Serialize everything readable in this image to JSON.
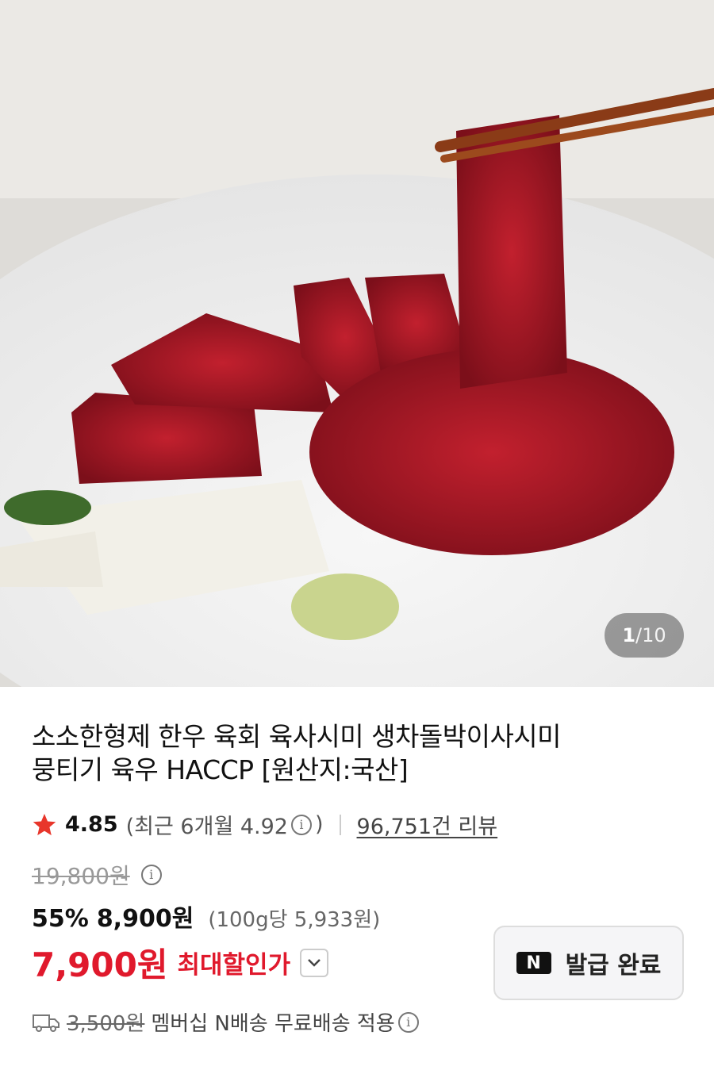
{
  "image": {
    "counter_current": "1",
    "counter_separator": "/",
    "counter_total": "10"
  },
  "product": {
    "title_line1": "소소한형제 한우 육회 육사시미 생차돌박이사시미",
    "title_line2": "뭉티기 육우 HACCP [원산지:국산]"
  },
  "rating": {
    "score": "4.85",
    "recent_prefix": "(최근 6개월 4.92",
    "recent_suffix": ")",
    "reviews": "96,751건 리뷰"
  },
  "price": {
    "original": "19,800원",
    "discount_rate": "55%",
    "sale": "8,900원",
    "unit_price": "(100g당 5,933원)",
    "max_discount": "7,900원",
    "max_label": "최대할인가"
  },
  "coupon": {
    "badge": "N",
    "label": "발급 완료"
  },
  "shipping": {
    "original_fee": "3,500원",
    "text": "멤버십 N배송 무료배송 적용"
  },
  "colors": {
    "accent_red": "#e0192c",
    "star": "#e8362b"
  }
}
